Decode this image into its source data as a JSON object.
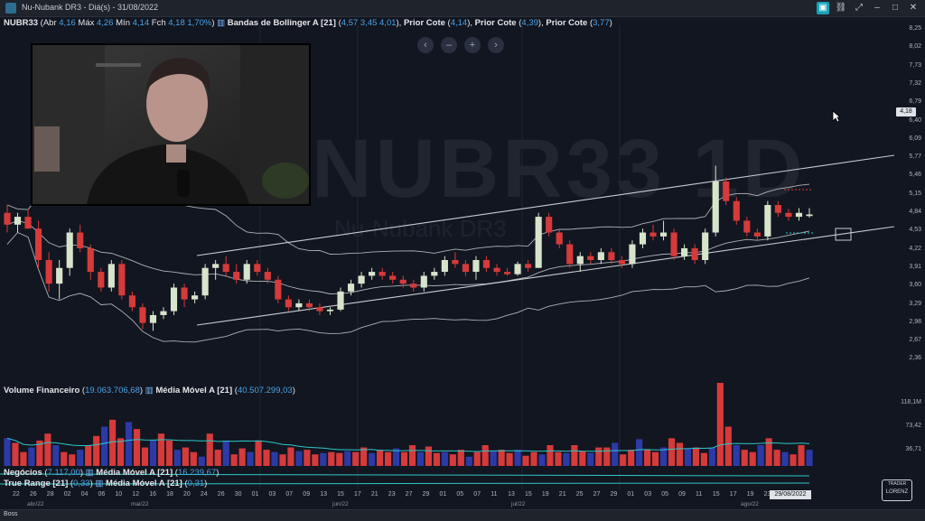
{
  "window": {
    "title": "Nu-Nubank DR3 - Diá(s) - 31/08/2022"
  },
  "legend": {
    "symbol": "NUBR33",
    "abr_label": "Abr",
    "abr": "4,16",
    "max_label": "Máx",
    "max": "4,26",
    "min_label": "Mín",
    "min": "4,14",
    "fch_label": "Fch",
    "fch": "4,18",
    "chg": "1,70%",
    "bollinger_label": "Bandas de Bollinger A [21]",
    "bollinger_values": "4,57  3,45 4,01",
    "prior1_label": "Prior Cote",
    "prior1": "4,14",
    "prior2_label": "Prior Cote",
    "prior2": "4,39",
    "prior3_label": "Prior Cote",
    "prior3": "3,77"
  },
  "volume_legend": {
    "label": "Volume Financeiro",
    "value": "19.063.706,68",
    "ma_label": "Média Móvel A [21]",
    "ma_value": "40.507.299,03"
  },
  "negocios_legend": {
    "label": "Negócios",
    "value": "7.117,00",
    "ma_label": "Média Móvel A [21]",
    "ma_value": "16.239,67"
  },
  "truerange_legend": {
    "label": "True Range [21]",
    "value": "0,33",
    "ma_label": "Média Móvel A [21]",
    "ma_value": "0,31"
  },
  "nav_buttons": [
    "‹",
    "–",
    "+",
    "›"
  ],
  "watermark": "NUBR33 1D",
  "watermark_sub": "Nu-Nubank DR3",
  "price_badge": "4,18",
  "date_badge": "29/08/2022",
  "price_axis": [
    "8,25",
    "8,02",
    "7,73",
    "7,32",
    "6,79",
    "6,40",
    "6,09",
    "5,77",
    "5,46",
    "5,15",
    "4,84",
    "4,53",
    "4,22",
    "3,91",
    "3,60",
    "3,29",
    "2,98",
    "2,67",
    "2,36"
  ],
  "volume_axis": [
    "118,1M",
    "73,42",
    "36,71"
  ],
  "x_days": [
    "22",
    "26",
    "28",
    "02",
    "04",
    "06",
    "10",
    "12",
    "16",
    "18",
    "20",
    "24",
    "26",
    "30",
    "01",
    "03",
    "07",
    "09",
    "13",
    "15",
    "17",
    "21",
    "23",
    "27",
    "29",
    "01",
    "05",
    "07",
    "11",
    "13",
    "15",
    "19",
    "21",
    "25",
    "27",
    "29",
    "01",
    "03",
    "05",
    "09",
    "11",
    "15",
    "17",
    "19",
    "23",
    "25"
  ],
  "x_months": [
    "abr/22",
    "mai/22",
    "jun/22",
    "jul/22",
    "ago/22"
  ],
  "logo_text": "LORENZ",
  "status_tab": "Boss",
  "colors": {
    "up": "#d7e4cc",
    "down": "#d63a3a",
    "volume_up": "#2c3aa8",
    "volume_down": "#d63a3a",
    "band": "#c8ccd2",
    "ma": "#2ec6c8",
    "dotted": "#2ec6c8"
  },
  "chart_data": {
    "type": "candlestick",
    "title": "NUBR33",
    "candles": [
      {
        "o": 4.2,
        "h": 4.3,
        "l": 3.95,
        "c": 4.05
      },
      {
        "o": 4.05,
        "h": 4.2,
        "l": 3.95,
        "c": 4.15
      },
      {
        "o": 4.15,
        "h": 4.25,
        "l": 4.0,
        "c": 4.0
      },
      {
        "o": 4.0,
        "h": 4.1,
        "l": 3.5,
        "c": 3.6
      },
      {
        "o": 3.6,
        "h": 3.7,
        "l": 3.2,
        "c": 3.3
      },
      {
        "o": 3.3,
        "h": 3.6,
        "l": 3.1,
        "c": 3.5
      },
      {
        "o": 3.5,
        "h": 4.0,
        "l": 3.4,
        "c": 3.95
      },
      {
        "o": 3.95,
        "h": 4.05,
        "l": 3.7,
        "c": 3.75
      },
      {
        "o": 3.75,
        "h": 3.8,
        "l": 3.35,
        "c": 3.45
      },
      {
        "o": 3.45,
        "h": 3.5,
        "l": 3.2,
        "c": 3.25
      },
      {
        "o": 3.25,
        "h": 3.6,
        "l": 3.2,
        "c": 3.55
      },
      {
        "o": 3.55,
        "h": 3.6,
        "l": 3.1,
        "c": 3.15
      },
      {
        "o": 3.15,
        "h": 3.2,
        "l": 2.95,
        "c": 3.0
      },
      {
        "o": 3.0,
        "h": 3.05,
        "l": 2.72,
        "c": 2.8
      },
      {
        "o": 2.8,
        "h": 2.95,
        "l": 2.7,
        "c": 2.9
      },
      {
        "o": 2.9,
        "h": 3.0,
        "l": 2.85,
        "c": 2.95
      },
      {
        "o": 2.95,
        "h": 3.3,
        "l": 2.9,
        "c": 3.25
      },
      {
        "o": 3.25,
        "h": 3.3,
        "l": 3.0,
        "c": 3.1
      },
      {
        "o": 3.1,
        "h": 3.2,
        "l": 3.05,
        "c": 3.15
      },
      {
        "o": 3.15,
        "h": 3.55,
        "l": 3.1,
        "c": 3.5
      },
      {
        "o": 3.5,
        "h": 3.6,
        "l": 3.35,
        "c": 3.55
      },
      {
        "o": 3.55,
        "h": 3.65,
        "l": 3.4,
        "c": 3.45
      },
      {
        "o": 3.45,
        "h": 3.55,
        "l": 3.3,
        "c": 3.35
      },
      {
        "o": 3.35,
        "h": 3.6,
        "l": 3.3,
        "c": 3.55
      },
      {
        "o": 3.55,
        "h": 3.6,
        "l": 3.4,
        "c": 3.45
      },
      {
        "o": 3.45,
        "h": 3.5,
        "l": 3.3,
        "c": 3.35
      },
      {
        "o": 3.35,
        "h": 3.4,
        "l": 3.05,
        "c": 3.1
      },
      {
        "o": 3.1,
        "h": 3.15,
        "l": 2.95,
        "c": 3.0
      },
      {
        "o": 3.0,
        "h": 3.1,
        "l": 2.95,
        "c": 3.05
      },
      {
        "o": 3.05,
        "h": 3.1,
        "l": 2.95,
        "c": 3.0
      },
      {
        "o": 3.0,
        "h": 3.05,
        "l": 2.9,
        "c": 2.95
      },
      {
        "o": 2.95,
        "h": 3.0,
        "l": 2.9,
        "c": 2.97
      },
      {
        "o": 2.97,
        "h": 3.25,
        "l": 2.95,
        "c": 3.2
      },
      {
        "o": 3.2,
        "h": 3.35,
        "l": 3.15,
        "c": 3.3
      },
      {
        "o": 3.3,
        "h": 3.45,
        "l": 3.25,
        "c": 3.4
      },
      {
        "o": 3.4,
        "h": 3.5,
        "l": 3.35,
        "c": 3.45
      },
      {
        "o": 3.45,
        "h": 3.5,
        "l": 3.35,
        "c": 3.4
      },
      {
        "o": 3.4,
        "h": 3.45,
        "l": 3.3,
        "c": 3.35
      },
      {
        "o": 3.35,
        "h": 3.4,
        "l": 3.25,
        "c": 3.3
      },
      {
        "o": 3.3,
        "h": 3.35,
        "l": 3.2,
        "c": 3.25
      },
      {
        "o": 3.25,
        "h": 3.45,
        "l": 3.2,
        "c": 3.4
      },
      {
        "o": 3.4,
        "h": 3.5,
        "l": 3.35,
        "c": 3.45
      },
      {
        "o": 3.45,
        "h": 3.65,
        "l": 3.4,
        "c": 3.6
      },
      {
        "o": 3.6,
        "h": 3.7,
        "l": 3.5,
        "c": 3.55
      },
      {
        "o": 3.55,
        "h": 3.6,
        "l": 3.4,
        "c": 3.45
      },
      {
        "o": 3.45,
        "h": 3.65,
        "l": 3.35,
        "c": 3.6
      },
      {
        "o": 3.6,
        "h": 3.65,
        "l": 3.45,
        "c": 3.5
      },
      {
        "o": 3.5,
        "h": 3.55,
        "l": 3.4,
        "c": 3.45
      },
      {
        "o": 3.45,
        "h": 3.5,
        "l": 3.4,
        "c": 3.42
      },
      {
        "o": 3.42,
        "h": 3.58,
        "l": 3.4,
        "c": 3.55
      },
      {
        "o": 3.55,
        "h": 3.6,
        "l": 3.45,
        "c": 3.5
      },
      {
        "o": 3.5,
        "h": 4.2,
        "l": 3.5,
        "c": 4.15
      },
      {
        "o": 4.15,
        "h": 4.2,
        "l": 3.9,
        "c": 3.95
      },
      {
        "o": 3.95,
        "h": 4.0,
        "l": 3.75,
        "c": 3.8
      },
      {
        "o": 3.8,
        "h": 3.85,
        "l": 3.5,
        "c": 3.55
      },
      {
        "o": 3.55,
        "h": 3.7,
        "l": 3.45,
        "c": 3.65
      },
      {
        "o": 3.65,
        "h": 3.7,
        "l": 3.55,
        "c": 3.6
      },
      {
        "o": 3.6,
        "h": 3.75,
        "l": 3.55,
        "c": 3.7
      },
      {
        "o": 3.7,
        "h": 3.75,
        "l": 3.55,
        "c": 3.6
      },
      {
        "o": 3.6,
        "h": 3.65,
        "l": 3.5,
        "c": 3.55
      },
      {
        "o": 3.55,
        "h": 3.85,
        "l": 3.5,
        "c": 3.8
      },
      {
        "o": 3.8,
        "h": 4.0,
        "l": 3.75,
        "c": 3.95
      },
      {
        "o": 3.95,
        "h": 4.05,
        "l": 3.85,
        "c": 3.9
      },
      {
        "o": 3.9,
        "h": 4.1,
        "l": 3.85,
        "c": 3.95
      },
      {
        "o": 3.95,
        "h": 4.0,
        "l": 3.6,
        "c": 3.65
      },
      {
        "o": 3.65,
        "h": 3.8,
        "l": 3.6,
        "c": 3.75
      },
      {
        "o": 3.75,
        "h": 3.8,
        "l": 3.55,
        "c": 3.6
      },
      {
        "o": 3.6,
        "h": 4.0,
        "l": 3.55,
        "c": 3.95
      },
      {
        "o": 3.95,
        "h": 4.8,
        "l": 3.9,
        "c": 4.6
      },
      {
        "o": 4.6,
        "h": 4.65,
        "l": 4.3,
        "c": 4.35
      },
      {
        "o": 4.35,
        "h": 4.4,
        "l": 4.05,
        "c": 4.1
      },
      {
        "o": 4.1,
        "h": 4.15,
        "l": 3.9,
        "c": 3.95
      },
      {
        "o": 3.95,
        "h": 4.0,
        "l": 3.85,
        "c": 3.9
      },
      {
        "o": 3.9,
        "h": 4.35,
        "l": 3.85,
        "c": 4.3
      },
      {
        "o": 4.3,
        "h": 4.35,
        "l": 4.15,
        "c": 4.2
      },
      {
        "o": 4.2,
        "h": 4.25,
        "l": 4.1,
        "c": 4.15
      },
      {
        "o": 4.15,
        "h": 4.26,
        "l": 4.1,
        "c": 4.2
      },
      {
        "o": 4.16,
        "h": 4.26,
        "l": 4.14,
        "c": 4.18
      }
    ],
    "volume": [
      60,
      50,
      30,
      40,
      55,
      70,
      45,
      30,
      25,
      35,
      45,
      65,
      85,
      100,
      60,
      95,
      80,
      40,
      55,
      70,
      55,
      35,
      40,
      30,
      20,
      70,
      35,
      55,
      25,
      38,
      30,
      55,
      35,
      30,
      25,
      40,
      32,
      35,
      25,
      28,
      30,
      28,
      32,
      30,
      40,
      28,
      35,
      30,
      38,
      30,
      45,
      30,
      42,
      28,
      30,
      25,
      35,
      20,
      30,
      45,
      32,
      35,
      28,
      35,
      22,
      30,
      25,
      45,
      30,
      28,
      45,
      32,
      28,
      40,
      40,
      50,
      25,
      35,
      58,
      35,
      30,
      40,
      60,
      50,
      38,
      40,
      28,
      40,
      180,
      85,
      45,
      35,
      30,
      45,
      60,
      35,
      30,
      25,
      45,
      35
    ]
  }
}
